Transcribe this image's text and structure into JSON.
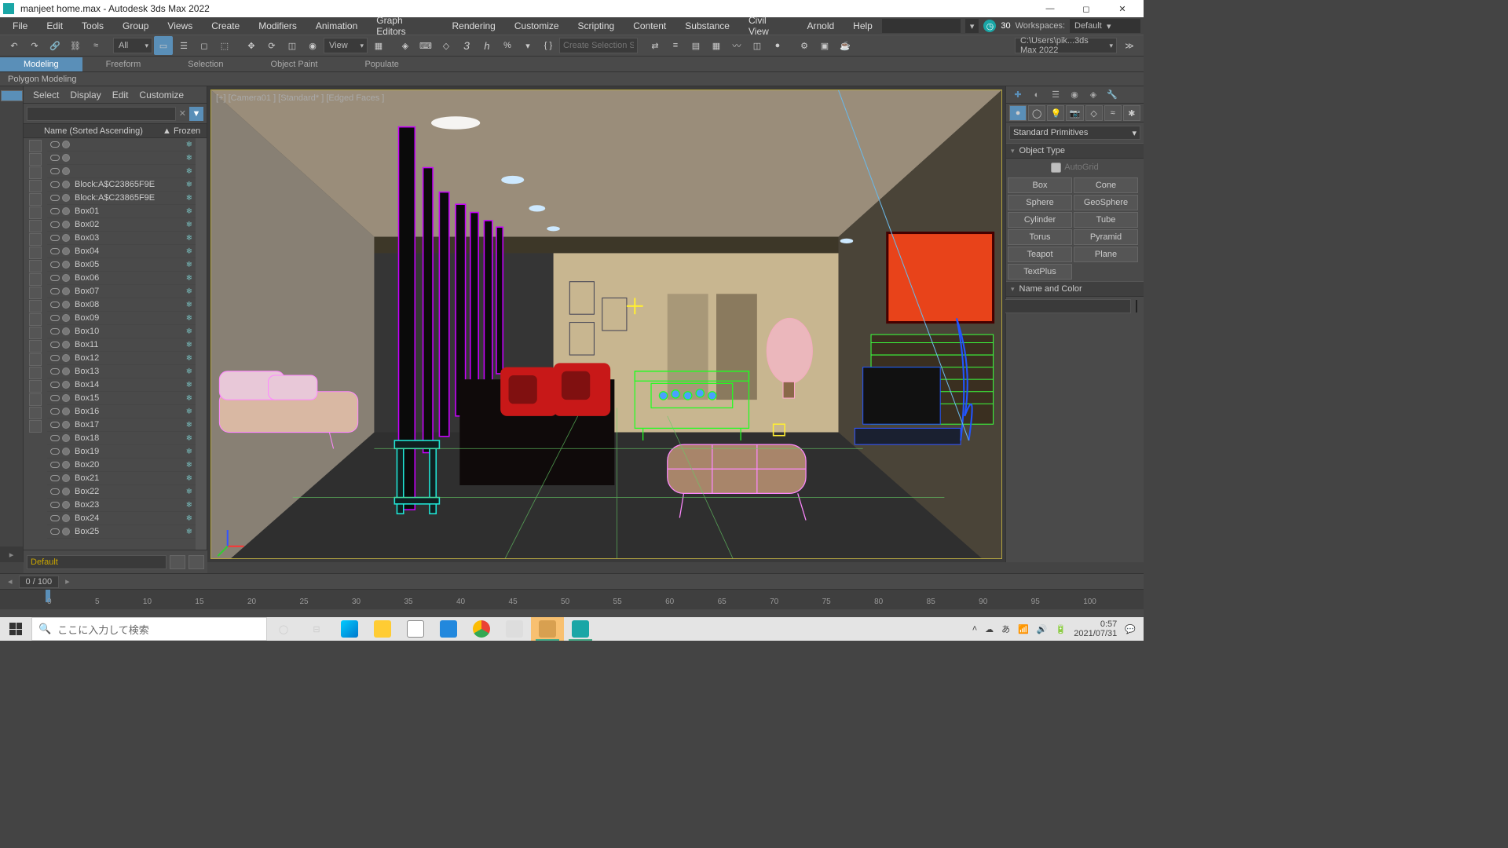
{
  "titlebar": {
    "text": "manjeet home.max - Autodesk 3ds Max 2022"
  },
  "menubar": {
    "items": [
      "File",
      "Edit",
      "Tools",
      "Group",
      "Views",
      "Create",
      "Modifiers",
      "Animation",
      "Graph Editors",
      "Rendering",
      "Customize",
      "Scripting",
      "Content",
      "Substance",
      "Civil View",
      "Arnold",
      "Help"
    ],
    "frames": "30",
    "workspaces_label": "Workspaces:",
    "workspace": "Default"
  },
  "toolbar": {
    "filter": "All",
    "view_label": "View",
    "sel_set_placeholder": "Create Selection Set",
    "path": "C:\\Users\\pik...3ds Max 2022"
  },
  "ribbon": {
    "tabs": [
      "Modeling",
      "Freeform",
      "Selection",
      "Object Paint",
      "Populate"
    ],
    "sub": "Polygon Modeling"
  },
  "explorer": {
    "menu": [
      "Select",
      "Display",
      "Edit",
      "Customize"
    ],
    "col_name": "Name (Sorted Ascending)",
    "col_frozen": "▲ Frozen",
    "items": [
      "",
      "",
      "",
      "Block:A$C23865F9E",
      "Block:A$C23865F9E",
      "Box01",
      "Box02",
      "Box03",
      "Box04",
      "Box05",
      "Box06",
      "Box07",
      "Box08",
      "Box09",
      "Box10",
      "Box11",
      "Box12",
      "Box13",
      "Box14",
      "Box15",
      "Box16",
      "Box17",
      "Box18",
      "Box19",
      "Box20",
      "Box21",
      "Box22",
      "Box23",
      "Box24",
      "Box25"
    ],
    "layer": "Default"
  },
  "viewport": {
    "label": "[+] [Camera01 ] [Standard* ] [Edged Faces ]"
  },
  "command": {
    "category": "Standard Primitives",
    "object_type": "Object Type",
    "autogrid": "AutoGrid",
    "buttons": [
      "Box",
      "Cone",
      "Sphere",
      "GeoSphere",
      "Cylinder",
      "Tube",
      "Torus",
      "Pyramid",
      "Teapot",
      "Plane",
      "TextPlus"
    ],
    "name_color": "Name and Color",
    "color": "#b3195a"
  },
  "time": {
    "frame": "0 / 100",
    "ticks": [
      "0",
      "5",
      "10",
      "15",
      "20",
      "25",
      "30",
      "35",
      "40",
      "45",
      "50",
      "55",
      "60",
      "65",
      "70",
      "75",
      "80",
      "85",
      "90",
      "95",
      "100"
    ]
  },
  "taskbar": {
    "search": "ここに入力して検索",
    "time": "0:57",
    "date": "2021/07/31"
  }
}
